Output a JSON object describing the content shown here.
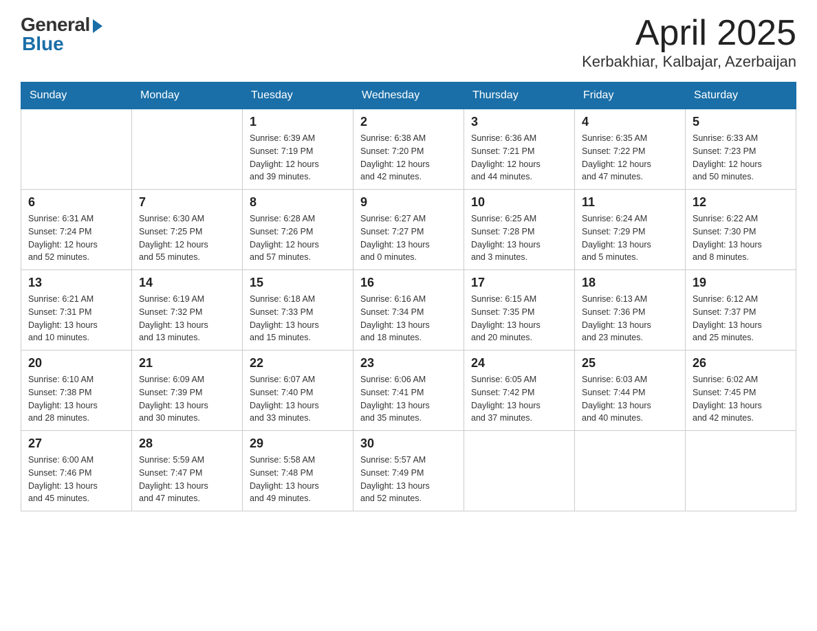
{
  "logo": {
    "general": "General",
    "blue": "Blue"
  },
  "header": {
    "month": "April 2025",
    "location": "Kerbakhiar, Kalbajar, Azerbaijan"
  },
  "weekdays": [
    "Sunday",
    "Monday",
    "Tuesday",
    "Wednesday",
    "Thursday",
    "Friday",
    "Saturday"
  ],
  "weeks": [
    [
      {
        "day": "",
        "info": ""
      },
      {
        "day": "",
        "info": ""
      },
      {
        "day": "1",
        "info": "Sunrise: 6:39 AM\nSunset: 7:19 PM\nDaylight: 12 hours\nand 39 minutes."
      },
      {
        "day": "2",
        "info": "Sunrise: 6:38 AM\nSunset: 7:20 PM\nDaylight: 12 hours\nand 42 minutes."
      },
      {
        "day": "3",
        "info": "Sunrise: 6:36 AM\nSunset: 7:21 PM\nDaylight: 12 hours\nand 44 minutes."
      },
      {
        "day": "4",
        "info": "Sunrise: 6:35 AM\nSunset: 7:22 PM\nDaylight: 12 hours\nand 47 minutes."
      },
      {
        "day": "5",
        "info": "Sunrise: 6:33 AM\nSunset: 7:23 PM\nDaylight: 12 hours\nand 50 minutes."
      }
    ],
    [
      {
        "day": "6",
        "info": "Sunrise: 6:31 AM\nSunset: 7:24 PM\nDaylight: 12 hours\nand 52 minutes."
      },
      {
        "day": "7",
        "info": "Sunrise: 6:30 AM\nSunset: 7:25 PM\nDaylight: 12 hours\nand 55 minutes."
      },
      {
        "day": "8",
        "info": "Sunrise: 6:28 AM\nSunset: 7:26 PM\nDaylight: 12 hours\nand 57 minutes."
      },
      {
        "day": "9",
        "info": "Sunrise: 6:27 AM\nSunset: 7:27 PM\nDaylight: 13 hours\nand 0 minutes."
      },
      {
        "day": "10",
        "info": "Sunrise: 6:25 AM\nSunset: 7:28 PM\nDaylight: 13 hours\nand 3 minutes."
      },
      {
        "day": "11",
        "info": "Sunrise: 6:24 AM\nSunset: 7:29 PM\nDaylight: 13 hours\nand 5 minutes."
      },
      {
        "day": "12",
        "info": "Sunrise: 6:22 AM\nSunset: 7:30 PM\nDaylight: 13 hours\nand 8 minutes."
      }
    ],
    [
      {
        "day": "13",
        "info": "Sunrise: 6:21 AM\nSunset: 7:31 PM\nDaylight: 13 hours\nand 10 minutes."
      },
      {
        "day": "14",
        "info": "Sunrise: 6:19 AM\nSunset: 7:32 PM\nDaylight: 13 hours\nand 13 minutes."
      },
      {
        "day": "15",
        "info": "Sunrise: 6:18 AM\nSunset: 7:33 PM\nDaylight: 13 hours\nand 15 minutes."
      },
      {
        "day": "16",
        "info": "Sunrise: 6:16 AM\nSunset: 7:34 PM\nDaylight: 13 hours\nand 18 minutes."
      },
      {
        "day": "17",
        "info": "Sunrise: 6:15 AM\nSunset: 7:35 PM\nDaylight: 13 hours\nand 20 minutes."
      },
      {
        "day": "18",
        "info": "Sunrise: 6:13 AM\nSunset: 7:36 PM\nDaylight: 13 hours\nand 23 minutes."
      },
      {
        "day": "19",
        "info": "Sunrise: 6:12 AM\nSunset: 7:37 PM\nDaylight: 13 hours\nand 25 minutes."
      }
    ],
    [
      {
        "day": "20",
        "info": "Sunrise: 6:10 AM\nSunset: 7:38 PM\nDaylight: 13 hours\nand 28 minutes."
      },
      {
        "day": "21",
        "info": "Sunrise: 6:09 AM\nSunset: 7:39 PM\nDaylight: 13 hours\nand 30 minutes."
      },
      {
        "day": "22",
        "info": "Sunrise: 6:07 AM\nSunset: 7:40 PM\nDaylight: 13 hours\nand 33 minutes."
      },
      {
        "day": "23",
        "info": "Sunrise: 6:06 AM\nSunset: 7:41 PM\nDaylight: 13 hours\nand 35 minutes."
      },
      {
        "day": "24",
        "info": "Sunrise: 6:05 AM\nSunset: 7:42 PM\nDaylight: 13 hours\nand 37 minutes."
      },
      {
        "day": "25",
        "info": "Sunrise: 6:03 AM\nSunset: 7:44 PM\nDaylight: 13 hours\nand 40 minutes."
      },
      {
        "day": "26",
        "info": "Sunrise: 6:02 AM\nSunset: 7:45 PM\nDaylight: 13 hours\nand 42 minutes."
      }
    ],
    [
      {
        "day": "27",
        "info": "Sunrise: 6:00 AM\nSunset: 7:46 PM\nDaylight: 13 hours\nand 45 minutes."
      },
      {
        "day": "28",
        "info": "Sunrise: 5:59 AM\nSunset: 7:47 PM\nDaylight: 13 hours\nand 47 minutes."
      },
      {
        "day": "29",
        "info": "Sunrise: 5:58 AM\nSunset: 7:48 PM\nDaylight: 13 hours\nand 49 minutes."
      },
      {
        "day": "30",
        "info": "Sunrise: 5:57 AM\nSunset: 7:49 PM\nDaylight: 13 hours\nand 52 minutes."
      },
      {
        "day": "",
        "info": ""
      },
      {
        "day": "",
        "info": ""
      },
      {
        "day": "",
        "info": ""
      }
    ]
  ]
}
